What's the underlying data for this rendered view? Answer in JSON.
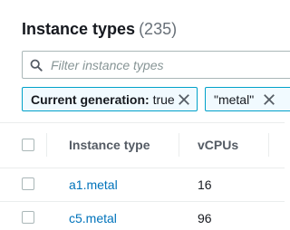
{
  "header": {
    "title": "Instance types",
    "count": "(235)"
  },
  "search": {
    "placeholder": "Filter instance types",
    "value": ""
  },
  "filters": [
    {
      "key": "Current generation:",
      "value": "true"
    },
    {
      "value": "\"metal\""
    }
  ],
  "table": {
    "columns": [
      "Instance type",
      "vCPUs"
    ],
    "rows": [
      {
        "instance_type": "a1.metal",
        "vcpus": "16"
      },
      {
        "instance_type": "c5.metal",
        "vcpus": "96"
      }
    ]
  },
  "colors": {
    "link": "#0073bb",
    "token_border": "#00a1c9",
    "token_bg": "#f1faff"
  }
}
